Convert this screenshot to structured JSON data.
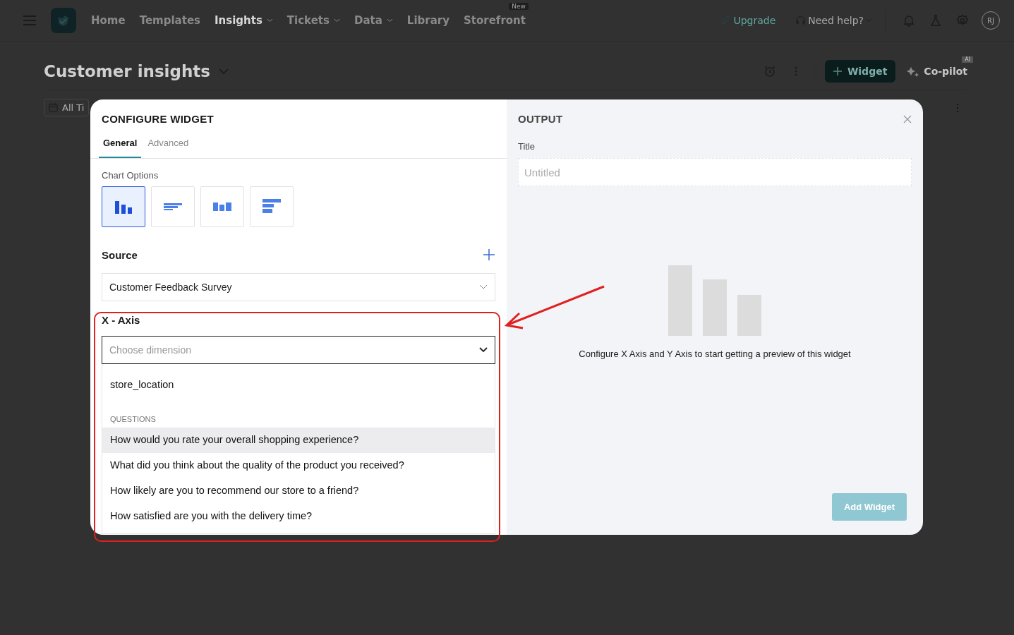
{
  "nav": {
    "items": [
      {
        "label": "Home",
        "selected": false,
        "dropdown": false
      },
      {
        "label": "Templates",
        "selected": false,
        "dropdown": false
      },
      {
        "label": "Insights",
        "selected": true,
        "dropdown": true
      },
      {
        "label": "Tickets",
        "selected": false,
        "dropdown": true
      },
      {
        "label": "Data",
        "selected": false,
        "dropdown": true
      },
      {
        "label": "Library",
        "selected": false,
        "dropdown": false
      },
      {
        "label": "Storefront",
        "selected": false,
        "dropdown": false,
        "badge": "New"
      }
    ],
    "upgrade": "Upgrade",
    "help": "Need help?",
    "avatar": "RJ"
  },
  "page": {
    "title": "Customer insights",
    "widget_button": "Widget",
    "copilot": "Co-pilot",
    "copilot_badge": "AI",
    "date_filter": "All Ti"
  },
  "modal": {
    "title": "CONFIGURE WIDGET",
    "tabs": [
      {
        "label": "General",
        "selected": true
      },
      {
        "label": "Advanced",
        "selected": false
      }
    ],
    "chart_options_label": "Chart Options",
    "chart_options": [
      {
        "kind": "column",
        "selected": true
      },
      {
        "kind": "bar",
        "selected": false
      },
      {
        "kind": "grid",
        "selected": false
      },
      {
        "kind": "stacked",
        "selected": false
      }
    ],
    "source_label": "Source",
    "source_value": "Customer Feedback Survey",
    "x_axis_label": "X - Axis",
    "x_axis_placeholder": "Choose dimension",
    "options": [
      {
        "kind": "option",
        "label": "store_location",
        "highlighted": false
      },
      {
        "kind": "group",
        "label": "QUESTIONS"
      },
      {
        "kind": "option",
        "label": "How would you rate your overall shopping experience?",
        "highlighted": true
      },
      {
        "kind": "option",
        "label": "What did you think about the quality of the product you received?",
        "highlighted": false
      },
      {
        "kind": "option",
        "label": "How likely are you to recommend our store to a friend?",
        "highlighted": false
      },
      {
        "kind": "option",
        "label": "How satisfied are you with the delivery time?",
        "highlighted": false
      }
    ],
    "output_title": "OUTPUT",
    "title_label": "Title",
    "title_placeholder": "Untitled",
    "empty_message": "Configure X Axis and Y Axis to start getting a preview of this widget",
    "add_button": "Add Widget"
  }
}
